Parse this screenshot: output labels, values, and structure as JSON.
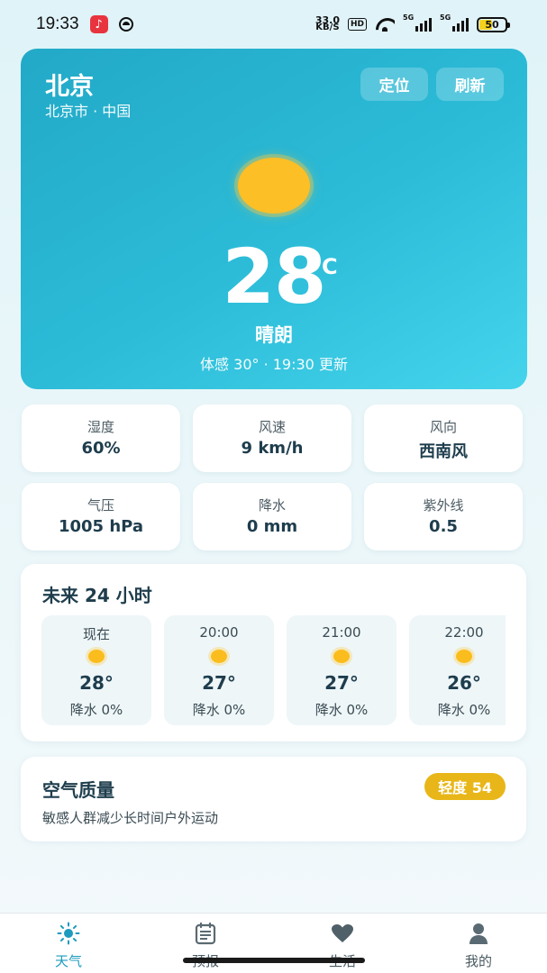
{
  "status_bar": {
    "time": "19:33",
    "net_speed_value": "33.0",
    "net_speed_unit": "KB/S",
    "hd_label": "HD",
    "signal_label_1": "5G",
    "signal_label_2": "5G",
    "battery": "50",
    "battery_level": 0.5
  },
  "hero": {
    "city": "北京",
    "region": "北京市 · 中国",
    "locate_label": "定位",
    "refresh_label": "刷新",
    "weather_icon": "sun-icon",
    "temperature": "28",
    "unit": "°C",
    "condition": "晴朗",
    "feels_like_line": "体感 30° · 19:30 更新",
    "accent": "#2cbcd8"
  },
  "metrics": [
    {
      "label": "湿度",
      "value": "60%"
    },
    {
      "label": "风速",
      "value": "9 km/h"
    },
    {
      "label": "风向",
      "value": "西南风"
    },
    {
      "label": "气压",
      "value": "1005 hPa"
    },
    {
      "label": "降水",
      "value": "0 mm"
    },
    {
      "label": "紫外线",
      "value": "0.5"
    }
  ],
  "forecast": {
    "title": "未来 24 小时",
    "hours": [
      {
        "time": "现在",
        "icon": "sun-icon",
        "temp": "28°",
        "rain": "降水 0%"
      },
      {
        "time": "20:00",
        "icon": "sun-icon",
        "temp": "27°",
        "rain": "降水 0%"
      },
      {
        "time": "21:00",
        "icon": "sun-icon",
        "temp": "27°",
        "rain": "降水 0%"
      },
      {
        "time": "22:00",
        "icon": "sun-icon",
        "temp": "26°",
        "rain": "降水 0%"
      }
    ]
  },
  "air_quality": {
    "title": "空气质量",
    "badge": "轻度 54",
    "badge_color": "#e8b618",
    "tip": "敏感人群减少长时间户外运动"
  },
  "nav": {
    "items": [
      {
        "label": "天气",
        "icon": "sun-icon",
        "active": true
      },
      {
        "label": "预报",
        "icon": "calendar-icon",
        "active": false
      },
      {
        "label": "生活",
        "icon": "heart-icon",
        "active": false
      },
      {
        "label": "我的",
        "icon": "person-icon",
        "active": false
      }
    ],
    "active_color": "#1c9bbd"
  }
}
